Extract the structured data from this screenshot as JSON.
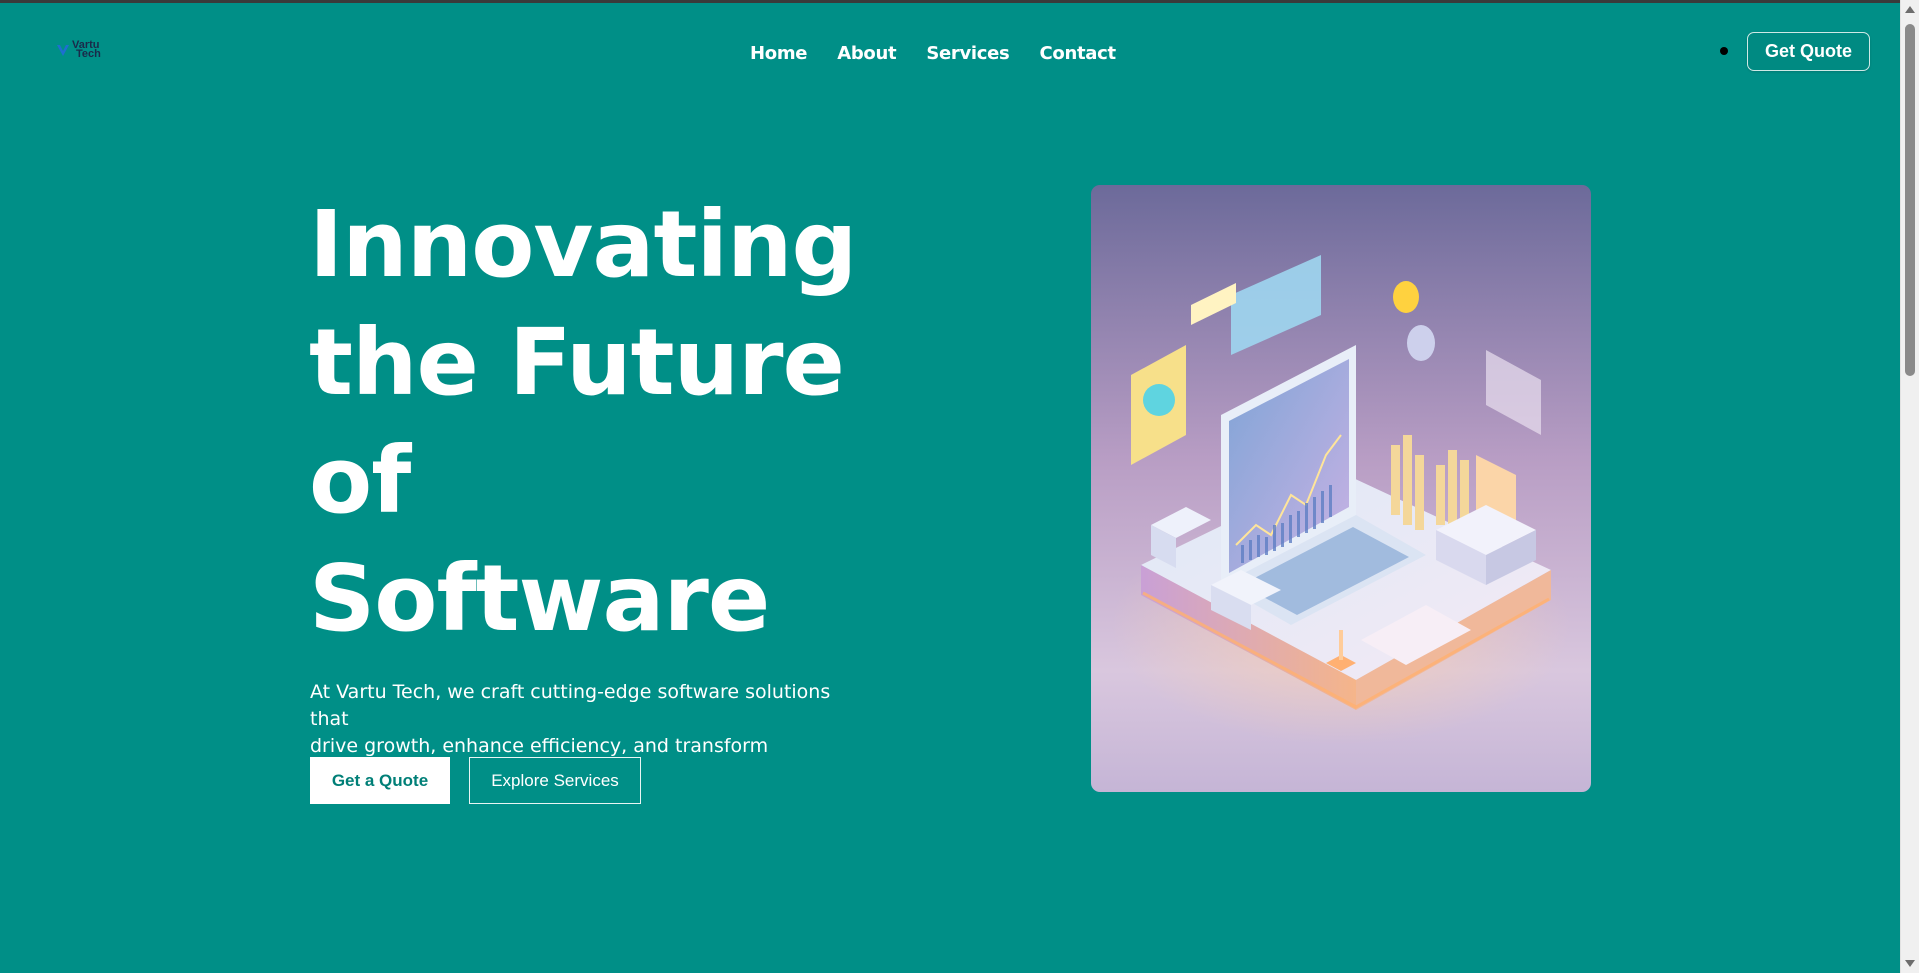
{
  "brand": {
    "name_line1": "Vartu",
    "name_line2": "Tech",
    "accent": "#1e6fd0"
  },
  "nav": {
    "items": [
      {
        "label": "Home"
      },
      {
        "label": "About"
      },
      {
        "label": "Services"
      },
      {
        "label": "Contact"
      }
    ]
  },
  "header": {
    "quote_button": "Get Quote"
  },
  "hero": {
    "title_lines": [
      "Innovating",
      "the Future",
      "of",
      "Software"
    ],
    "description_line1": "At Vartu Tech, we craft cutting-edge software solutions that",
    "description_line2": "drive growth, enhance efficiency, and transform businesses.",
    "primary_button": "Get a Quote",
    "secondary_button": "Explore Services"
  },
  "colors": {
    "background": "#008f87",
    "primary_text": "#ffffff",
    "button_text": "#007f77"
  }
}
